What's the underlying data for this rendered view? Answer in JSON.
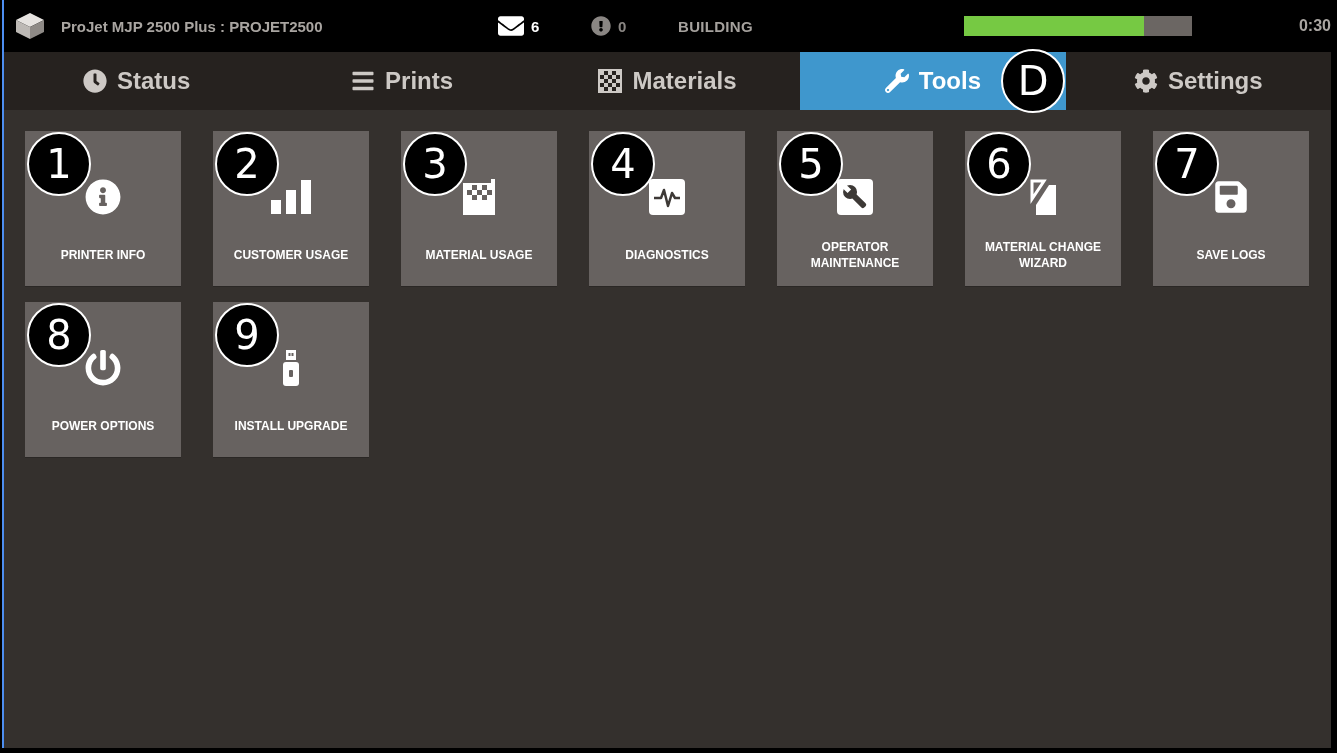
{
  "header": {
    "title": "ProJet MJP 2500 Plus : PROJET2500",
    "messages": "6",
    "alerts": "0",
    "status": "BUILDING",
    "progress": {
      "level": 0.79
    },
    "time": "0:30"
  },
  "tabs": [
    {
      "label": "Status",
      "selected": false
    },
    {
      "label": "Prints",
      "selected": false
    },
    {
      "label": "Materials",
      "selected": false
    },
    {
      "label": "Tools",
      "selected": true,
      "callout": "D"
    },
    {
      "label": "Settings",
      "selected": false
    }
  ],
  "tools": [
    {
      "label": "PRINTER INFO",
      "callout": "1"
    },
    {
      "label": "CUSTOMER USAGE",
      "callout": "2"
    },
    {
      "label": "MATERIAL USAGE",
      "callout": "3"
    },
    {
      "label": "DIAGNOSTICS",
      "callout": "4"
    },
    {
      "label": "OPERATOR MAINTENANCE",
      "callout": "5"
    },
    {
      "label": "MATERIAL CHANGE WIZARD",
      "callout": "6"
    },
    {
      "label": "SAVE LOGS",
      "callout": "7"
    },
    {
      "label": "POWER OPTIONS",
      "callout": "8"
    },
    {
      "label": "INSTALL UPGRADE",
      "callout": "9"
    }
  ]
}
